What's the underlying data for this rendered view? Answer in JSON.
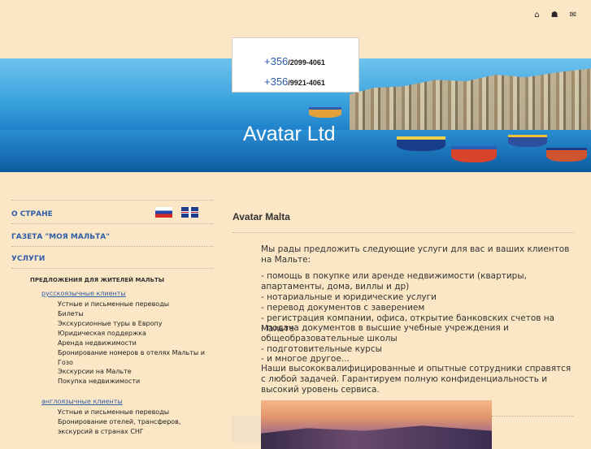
{
  "header": {
    "icons": [
      "home-icon",
      "sitemap-icon",
      "mail-icon"
    ],
    "icon_glyphs": [
      "⌂",
      "☗",
      "✉"
    ]
  },
  "banner": {
    "title": "Avatar Ltd"
  },
  "contacts": {
    "phone1_prefix": "+356",
    "phone1_number": "/2099-4061",
    "phone2_prefix": "+356",
    "phone2_number": "/9921-4061"
  },
  "nav": {
    "about": "О СТРАНЕ",
    "newspaper": "ГАЗЕТА \"МОЯ МАЛЬТА\"",
    "services": "УСЛУГИ",
    "offers_title": "ПРЕДЛОЖЕНИЯ ДЛЯ ЖИТЕЛЕЙ МАЛЬТЫ",
    "russian_clients": "русскоязычные клиенты",
    "russian_items": [
      "Устные и письменные переводы",
      "Билеты",
      "Экскурсионные туры в Европу",
      "Юридическая поддержка",
      "Аренда недвижимости",
      "Бронирование номеров в отелях Мальты и Гозо",
      "Экскурсии на Мальте",
      "Покупка недвижимости"
    ],
    "english_clients": "англоязычные клиенты",
    "english_items": [
      "Устные и письменные переводы",
      "Бронирование отелей, трансферов, экскурсий в странах СНГ"
    ]
  },
  "languages": {
    "ru_flag": "flag-russia",
    "en_flag": "flag-uk"
  },
  "main": {
    "title": "Avatar Malta",
    "intro": "Мы рады предложить следующие услуги для вас и ваших клиентов на Мальте:",
    "list": [
      "- помощь в покупке или аренде недвижимости (квартиры, апартаменты, дома, виллы и др)",
      "- нотариальные и юридические услуги",
      "- перевод документов с заверением",
      "- регистрация компании, офиса, открытие банковских счетов на Мальте",
      "- подача документов в высшие учебные учреждения и общеобразовательные школы",
      "- подготовительные курсы",
      "- и многое другое...",
      "Наши высококвалифицированные и опытные сотрудники справятся с любой задачей. Гарантируем полную конфиденциальность и высокий уровень сервиса."
    ]
  },
  "colors": {
    "page_bg": "#fbe7c6",
    "link": "#2f5da8",
    "text": "#333333"
  }
}
